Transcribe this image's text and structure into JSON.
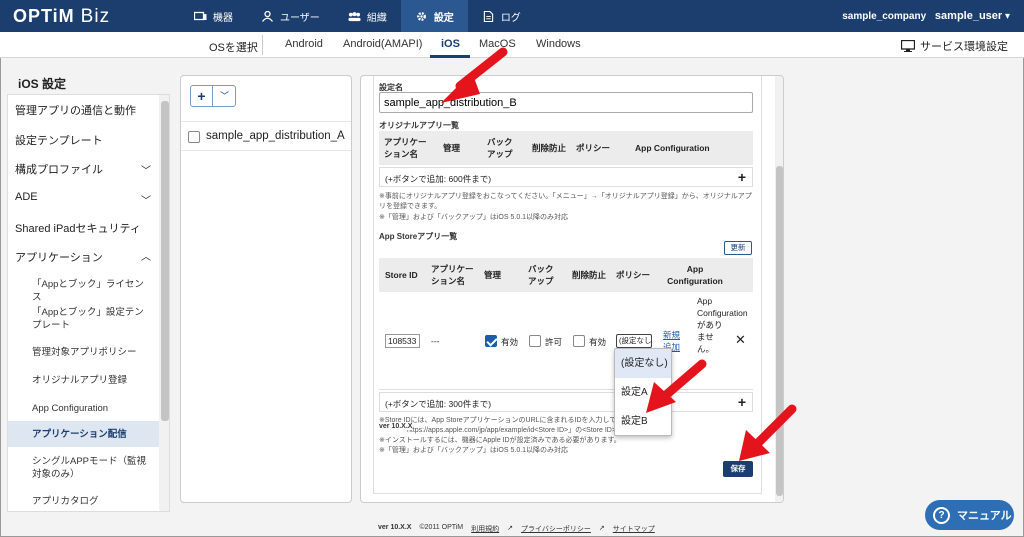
{
  "app": {
    "logo": "OPTiM",
    "logo_suffix": "Biz"
  },
  "nav": {
    "items": [
      {
        "label": "機器",
        "icon": "devices-icon"
      },
      {
        "label": "ユーザー",
        "icon": "user-icon"
      },
      {
        "label": "組織",
        "icon": "organization-icon"
      },
      {
        "label": "設定",
        "icon": "gear-icon"
      },
      {
        "label": "ログ",
        "icon": "log-icon"
      }
    ],
    "active": "設定",
    "company": "sample_company",
    "user": "sample_user"
  },
  "os_nav": {
    "select_label": "OSを選択",
    "tabs": [
      "Android",
      "Android(AMAPI)",
      "iOS",
      "MacOS",
      "Windows"
    ],
    "active": "iOS",
    "service_settings": "サービス環境設定"
  },
  "sidebar": {
    "title": "iOS 設定",
    "items": [
      "管理アプリの通信と動作",
      "設定テンプレート",
      "構成プロファイル",
      "ADE",
      "Shared iPadセキュリティ",
      "アプリケーション"
    ],
    "sub_items": [
      "「Appとブック」ライセンス",
      "「Appとブック」設定テンプレート",
      "管理対象アプリポリシー",
      "オリジナルアプリ登録",
      "App Configuration",
      "アプリケーション配信",
      "シングルAPPモード（監視対象のみ）",
      "アプリカタログ"
    ],
    "active_sub": "アプリケーション配信"
  },
  "list": {
    "add_label": "+",
    "items": [
      "sample_app_distribution_A"
    ]
  },
  "form": {
    "name_label": "設定名",
    "name_value": "sample_app_distribution_B",
    "original_section": "オリジナルアプリ一覧",
    "original_headers": [
      "アプリケーション名",
      "管理",
      "バックアップ",
      "削除防止",
      "ポリシー",
      "App Configuration"
    ],
    "original_add": "(+ボタンで追加: 600件まで)",
    "original_note1": "※事前にオリジナルアプリ登録をおこなってください。「メニュー」→「オリジナルアプリ登録」から、オリジナルアプリを登録できます。",
    "original_note2": "※「管理」および「バックアップ」はiOS 5.0.1以降のみ対応",
    "appstore_section": "App Storeアプリ一覧",
    "refresh_label": "更新",
    "appstore_headers": [
      "Store ID",
      "アプリケーション名",
      "管理",
      "バックアップ",
      "削除防止",
      "ポリシー",
      "App Configuration"
    ],
    "row": {
      "store_id": "108533",
      "app_name": "---",
      "manage_label": "有効",
      "manage_checked": true,
      "backup_label": "許可",
      "backup_checked": false,
      "protect_label": "有効",
      "protect_checked": false,
      "policy_value": "(設定なし)",
      "new_link": "新規追加",
      "app_config_text": "App Configurationがありません。"
    },
    "appstore_add": "(+ボタンで追加: 300件まで)",
    "appstore_note1": "※Store IDには、App StoreアプリケーションのURLに含まれるIDを入力してください。",
    "appstore_note2": "https://apps.apple.com/jp/app/example/id<Store ID>」の<Store ID>部分が入ります。",
    "appstore_note3": "※インストールするには、機器にApple IDが設定済みである必要があります。",
    "appstore_note4": "※「管理」および「バックアップ」はiOS 5.0.1以降のみ対応",
    "version_small": "ver 10.X.X",
    "save_label": "保存"
  },
  "dropdown": {
    "options": [
      "(設定なし)",
      "設定A",
      "設定B"
    ],
    "highlighted": "(設定なし)"
  },
  "footer": {
    "version": "ver 10.X.X",
    "copyright": "©2011 OPTiM",
    "terms": "利用規約",
    "privacy": "プライバシーポリシー",
    "sitemap": "サイトマップ"
  },
  "manual_label": "マニュアル",
  "colors": {
    "brand": "#1b3e6e",
    "arrow": "#e3141b",
    "manual": "#2d6eb5"
  }
}
